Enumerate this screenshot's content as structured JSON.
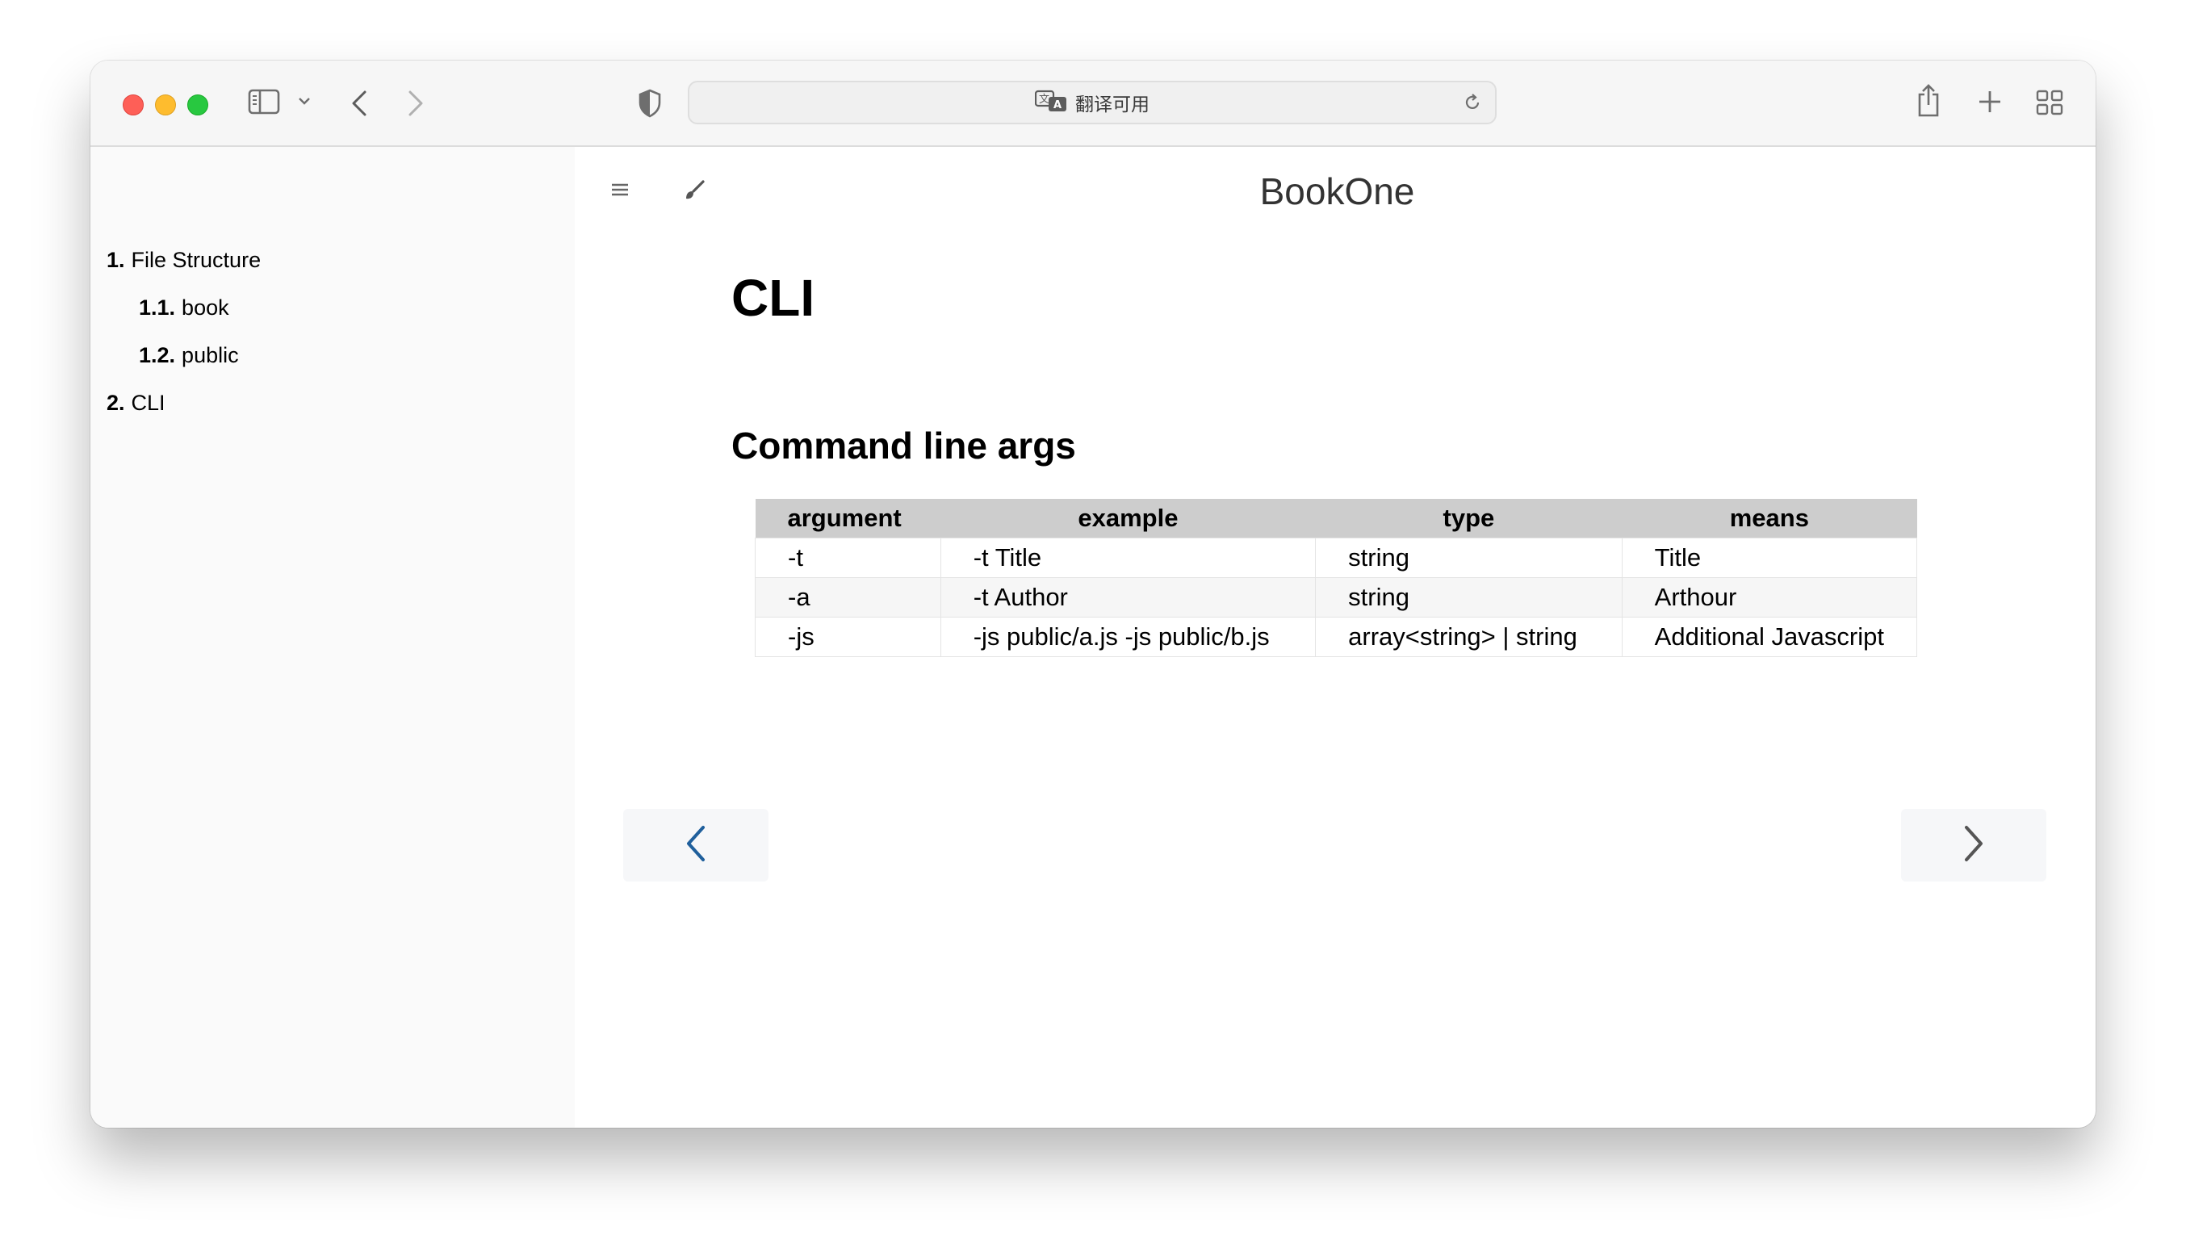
{
  "browser": {
    "address_text": "翻译可用"
  },
  "sidebar": {
    "items": [
      {
        "num": "1.",
        "label": "File Structure"
      },
      {
        "num": "1.1.",
        "label": "book"
      },
      {
        "num": "1.2.",
        "label": "public"
      },
      {
        "num": "2.",
        "label": "CLI"
      }
    ]
  },
  "book": {
    "title": "BookOne"
  },
  "page": {
    "title": "CLI",
    "section_title": "Command line args"
  },
  "table": {
    "headers": [
      "argument",
      "example",
      "type",
      "means"
    ],
    "rows": [
      [
        "-t",
        "-t Title",
        "string",
        "Title"
      ],
      [
        "-a",
        "-t Author",
        "string",
        "Arthour"
      ],
      [
        "-js",
        "-js public/a.js -js public/b.js",
        "array<string> | string",
        "Additional Javascript"
      ]
    ]
  },
  "colors": {
    "accent_link": "#1f5f9c",
    "table_header_bg": "#cdcdcd",
    "sidebar_bg": "#fafafa"
  }
}
